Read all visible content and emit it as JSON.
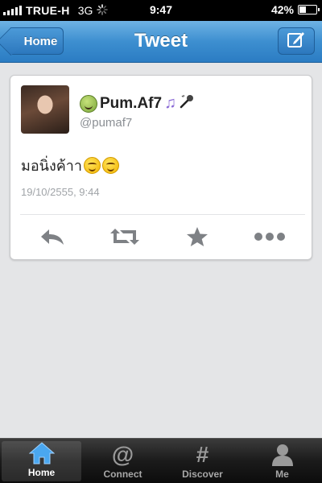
{
  "status_bar": {
    "carrier": "TRUE-H",
    "network": "3G",
    "time": "9:47",
    "battery": "42%",
    "battery_level": 0.42
  },
  "nav_bar": {
    "title": "Tweet",
    "back_label": "Home",
    "compose_icon": "compose-icon"
  },
  "tweet": {
    "display_name": "Pum.Af7",
    "handle": "@pumaf7",
    "text": "มอนิ่งค้าา",
    "timestamp": "19/10/2555, 9:44",
    "actions": [
      "reply-icon",
      "retweet-icon",
      "favorite-icon",
      "more-icon"
    ]
  },
  "tab_bar": {
    "tabs": [
      {
        "label": "Home",
        "icon": "home-icon",
        "active": true
      },
      {
        "label": "Connect",
        "icon": "at-icon",
        "active": false
      },
      {
        "label": "Discover",
        "icon": "hash-icon",
        "active": false
      },
      {
        "label": "Me",
        "icon": "person-icon",
        "active": false
      }
    ]
  },
  "colors": {
    "nav_blue": "#3d8fd0",
    "tab_active_icon": "#4aa7f0",
    "action_gray": "#8a8c8f"
  }
}
